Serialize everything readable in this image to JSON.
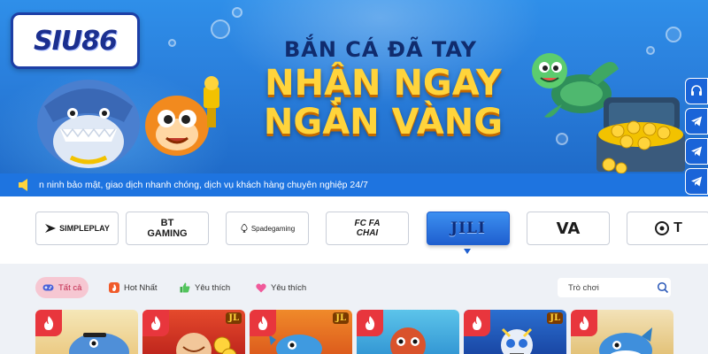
{
  "brand": {
    "logo_text": "SIU86"
  },
  "banner": {
    "line1": "BẮN CÁ ĐÃ TAY",
    "line2": "NHẬN NGAY",
    "line3": "NGÀN VÀNG"
  },
  "marquee": {
    "icon": "speaker-icon",
    "text": "n ninh bảo mật, giao dịch nhanh chóng, dịch vụ khách hàng chuyên nghiệp 24/7"
  },
  "side_buttons": [
    {
      "icon": "headset-icon"
    },
    {
      "icon": "telegram-icon"
    },
    {
      "icon": "telegram-icon"
    },
    {
      "icon": "telegram-icon"
    },
    {
      "icon": "gift-icon"
    }
  ],
  "providers": [
    {
      "label": "SIMPLEPLAY"
    },
    {
      "label": "BT GAMING"
    },
    {
      "label": "Spadegaming"
    },
    {
      "label": "FC FA CHAI"
    },
    {
      "label": "JILI",
      "selected": true
    },
    {
      "label": "VA"
    },
    {
      "label": "T"
    }
  ],
  "filters": [
    {
      "label": "Tất cả",
      "icon": "gamepad-icon",
      "active": true
    },
    {
      "label": "Hot Nhất",
      "icon": "hot-icon",
      "active": false
    },
    {
      "label": "Yêu thích",
      "icon": "thumbs-up-icon",
      "active": false
    },
    {
      "label": "Yêu thích",
      "icon": "heart-icon",
      "active": false
    }
  ],
  "search": {
    "placeholder": "Trò chơi"
  },
  "games": [
    {
      "badge": ""
    },
    {
      "badge": "JL"
    },
    {
      "badge": "JL"
    },
    {
      "badge": ""
    },
    {
      "badge": "JL"
    },
    {
      "badge": ""
    }
  ],
  "colors": {
    "banner_blue": "#2a7fdc",
    "marquee_blue": "#1e74e0",
    "headline_gold": "#ffd43b",
    "active_chip": "#f6c7d2",
    "hot_red": "#e8363d"
  }
}
